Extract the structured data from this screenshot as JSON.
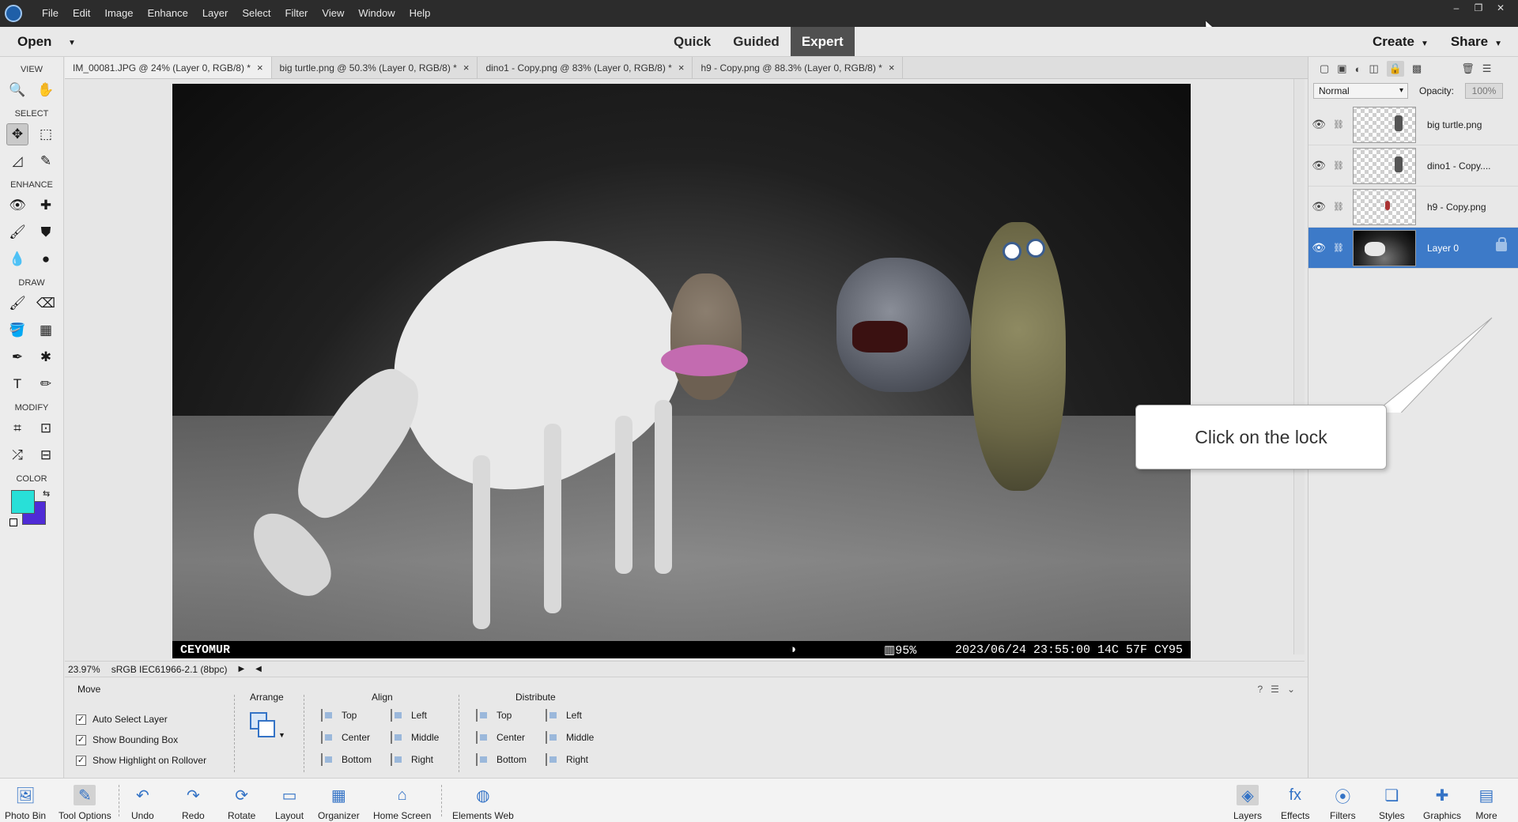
{
  "menu": [
    "File",
    "Edit",
    "Image",
    "Enhance",
    "Layer",
    "Select",
    "Filter",
    "View",
    "Window",
    "Help"
  ],
  "window_controls": {
    "minimize": "–",
    "restore": "❐",
    "close": "✕"
  },
  "modebar": {
    "open_label": "Open",
    "modes": [
      "Quick",
      "Guided",
      "Expert"
    ],
    "active_mode": "Expert",
    "create_label": "Create",
    "share_label": "Share"
  },
  "toolbox": {
    "view": "VIEW",
    "select": "SELECT",
    "enhance": "ENHANCE",
    "draw": "DRAW",
    "modify": "MODIFY",
    "color": "COLOR",
    "foreground_color": "#28e0d8",
    "background_color": "#4f2bd6"
  },
  "doc_tabs": [
    {
      "title": "IM_00081.JPG @ 24% (Layer 0, RGB/8) *",
      "active": true
    },
    {
      "title": "big turtle.png @ 50.3% (Layer 0, RGB/8) *",
      "active": false
    },
    {
      "title": "dino1 - Copy.png @ 83% (Layer 0, RGB/8) *",
      "active": false
    },
    {
      "title": "h9 - Copy.png @ 88.3% (Layer 0, RGB/8) *",
      "active": false
    }
  ],
  "photo": {
    "brand": "CEYOMUR",
    "battery": "95%",
    "stamp": "2023/06/24 23:55:00  14C 57F CY95"
  },
  "status": {
    "zoom": "23.97%",
    "profile": "sRGB IEC61966-2.1 (8bpc)"
  },
  "callout": {
    "text": "Click on the lock"
  },
  "layers_panel": {
    "blend_mode": "Normal",
    "opacity_label": "Opacity:",
    "opacity_value": "100%",
    "layers": [
      {
        "name": "big turtle.png",
        "selected": false
      },
      {
        "name": "dino1 - Copy....",
        "selected": false
      },
      {
        "name": "h9 - Copy.png",
        "selected": false
      },
      {
        "name": "Layer 0",
        "selected": true
      }
    ]
  },
  "tool_options": {
    "title": "Move",
    "checks": [
      {
        "label": "Auto Select Layer",
        "checked": true
      },
      {
        "label": "Show Bounding Box",
        "checked": true
      },
      {
        "label": "Show Highlight on Rollover",
        "checked": true
      }
    ],
    "arrange": "Arrange",
    "align": {
      "title": "Align",
      "top": "Top",
      "center": "Center",
      "bottom": "Bottom",
      "left": "Left",
      "middle": "Middle",
      "right": "Right"
    },
    "distribute": {
      "title": "Distribute",
      "top": "Top",
      "center": "Center",
      "bottom": "Bottom",
      "left": "Left",
      "middle": "Middle",
      "right": "Right"
    }
  },
  "taskbar": {
    "photo_bin": "Photo Bin",
    "tool_options": "Tool Options",
    "undo": "Undo",
    "redo": "Redo",
    "rotate": "Rotate",
    "layout": "Layout",
    "organizer": "Organizer",
    "home_screen": "Home Screen",
    "elements_web": "Elements Web",
    "layers": "Layers",
    "effects": "Effects",
    "filters": "Filters",
    "styles": "Styles",
    "graphics": "Graphics",
    "more": "More"
  }
}
